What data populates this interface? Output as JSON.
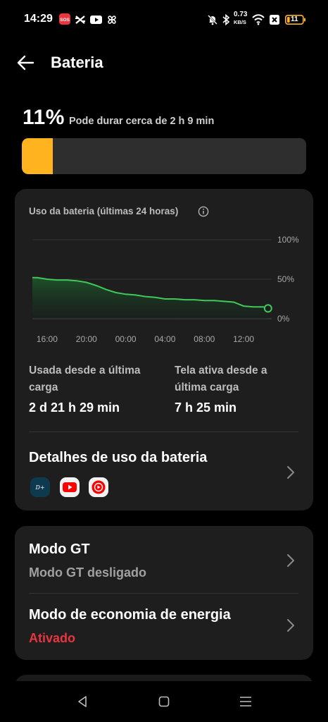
{
  "status_bar": {
    "time": "14:29",
    "net_speed_value": "0.73",
    "net_speed_unit": "KB/S",
    "battery_level": "11",
    "icons": [
      "sos-icon",
      "capcut-icon",
      "youtube-icon",
      "pinwheel-icon",
      "mute-icon",
      "bluetooth-icon",
      "wifi-icon",
      "sim-off-icon",
      "battery-icon"
    ]
  },
  "header": {
    "title": "Bateria"
  },
  "battery": {
    "percent": "11%",
    "estimate": "Pode durar cerca de 2 h 9 min",
    "level_fraction": 0.11,
    "fill_color": "#ffb41f"
  },
  "usage_card": {
    "title": "Uso da bateria (últimas 24 horas)",
    "chart_data": {
      "type": "area",
      "title": "Uso da bateria (últimas 24 horas)",
      "y_ticks": [
        "100%",
        "50%",
        "0%"
      ],
      "ylim": [
        0,
        100
      ],
      "x_ticks": [
        "16:00",
        "20:00",
        "00:00",
        "04:00",
        "08:00",
        "12:00"
      ],
      "grid": true,
      "line_color": "#3ec95a",
      "series": [
        {
          "x": [
            "14:30",
            "15:00",
            "16:00",
            "17:00",
            "18:00",
            "19:00",
            "20:00",
            "21:00",
            "22:00",
            "23:00",
            "00:00",
            "01:00",
            "02:00",
            "03:00",
            "04:00",
            "05:00",
            "06:00",
            "07:00",
            "08:00",
            "09:00",
            "10:00",
            "11:00",
            "12:00",
            "13:00",
            "14:00",
            "14:29"
          ],
          "values": [
            52,
            52,
            50,
            49,
            49,
            48,
            46,
            42,
            37,
            33,
            31,
            30,
            28,
            27,
            25,
            25,
            24,
            24,
            23,
            23,
            22,
            21,
            16,
            15,
            15,
            13
          ]
        }
      ]
    },
    "used_since_label": "Usada desde a última carga",
    "used_since_value": "2 d 21 h 29 min",
    "screen_on_label": "Tela ativa desde a última carga",
    "screen_on_value": "7 h 25 min",
    "details_title": "Detalhes de uso da bateria",
    "apps": [
      "disney-plus-icon",
      "youtube-icon",
      "youtube-music-icon"
    ]
  },
  "modes_card": {
    "gt_title": "Modo GT",
    "gt_status": "Modo GT desligado",
    "saver_title": "Modo de economia de energia",
    "saver_status": "Ativado",
    "saver_status_color": "#e8353e"
  },
  "nav_bar": {
    "buttons": [
      "back-nav-icon",
      "home-nav-icon",
      "recents-nav-icon"
    ]
  }
}
